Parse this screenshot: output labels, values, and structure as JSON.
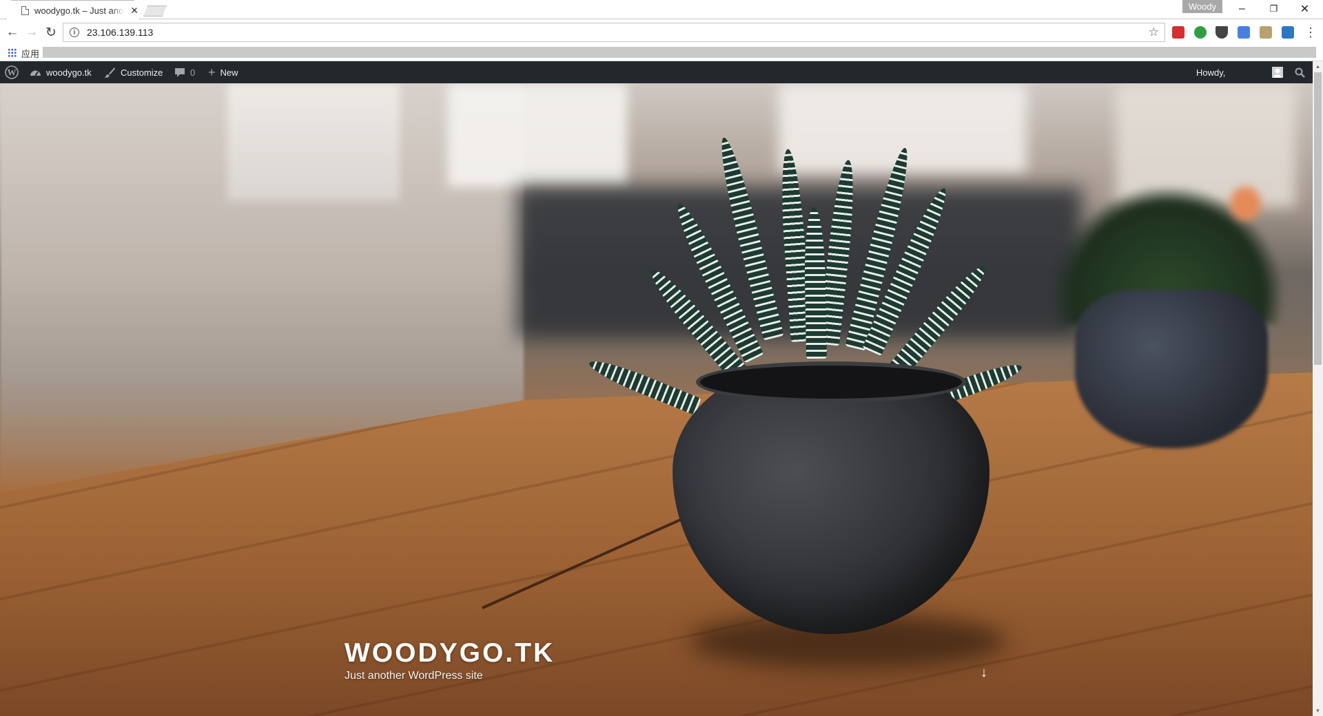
{
  "browser": {
    "tab_title": "woodygo.tk – Just another WordPress site",
    "tab_close": "✕",
    "profile_name": "Woody",
    "window_controls": {
      "minimize": "–",
      "restore": "❐",
      "close": "✕"
    },
    "url": "23.106.139.113",
    "nav": {
      "back": "←",
      "forward": "→",
      "reload": "↻"
    },
    "star": "☆",
    "extensions": [
      {
        "name": "lastpass-extension",
        "color": "#d32f2f"
      },
      {
        "name": "green-extension",
        "color": "#2e9e44"
      },
      {
        "name": "pocket-extension",
        "color": "#444444"
      },
      {
        "name": "translate-extension",
        "color": "#4a7fe0"
      },
      {
        "name": "image-extension",
        "color": "#b8a070"
      },
      {
        "name": "sync-extension",
        "color": "#2b78c2"
      }
    ],
    "menu": "⋮",
    "bookmarks": {
      "apps_label": "应用"
    }
  },
  "admin_bar": {
    "site_name": "woodygo.tk",
    "customize": "Customize",
    "comments_count": "0",
    "new_label": "New",
    "howdy": "Howdy,"
  },
  "hero": {
    "site_title": "WOODYGO.TK",
    "site_description": "Just another WordPress site",
    "scroll_arrow": "↓"
  },
  "colors": {
    "admin_bar_bg": "#23282d",
    "admin_bar_text": "#eeeeee"
  }
}
